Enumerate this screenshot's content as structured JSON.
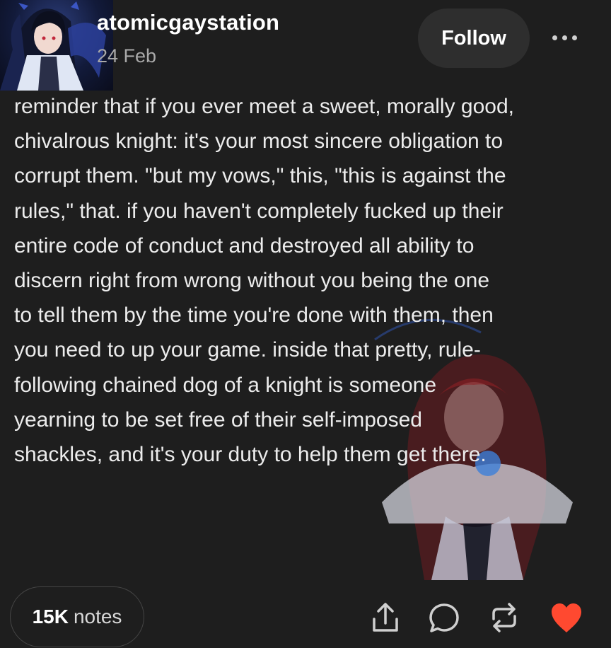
{
  "post": {
    "username": "atomicgaystation",
    "date": "24 Feb",
    "follow_label": "Follow",
    "body": "reminder that if you ever meet a sweet, morally good,\nchivalrous knight: it's your most sincere obligation to\ncorrupt them. \"but my vows,\" this, \"this is against the\nrules,\" that. if you haven't completely fucked up their\nentire code of conduct and destroyed all ability to\ndiscern right from wrong without you being the one\nto tell them by the time you're done with them, then\nyou need to up your game. inside that pretty, rule-\nfollowing chained dog of a knight is someone\nyearning to be set free of their self-imposed\nshackles, and it's your duty to help them get there."
  },
  "footer": {
    "notes_count": "15K",
    "notes_label": "notes"
  },
  "icons": {
    "share": "share-icon",
    "reply": "reply-icon",
    "reblog": "reblog-icon",
    "like": "heart-icon",
    "more": "more-icon"
  },
  "colors": {
    "background": "#1e1e1e",
    "like_active": "#ff4930",
    "secondary_text": "#a9a9a9"
  }
}
